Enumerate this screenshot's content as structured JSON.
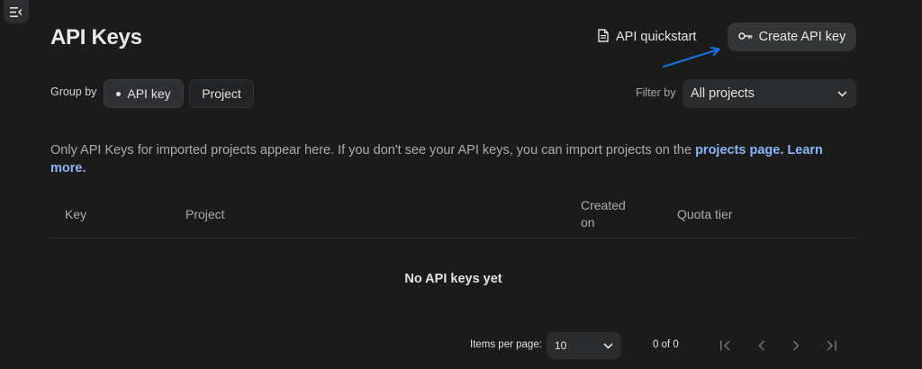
{
  "header": {
    "title": "API Keys",
    "quickstart_label": "API quickstart",
    "create_label": "Create API key"
  },
  "toolbar": {
    "group_by_label": "Group by",
    "group_options": [
      "API key",
      "Project"
    ],
    "selected_group": "API key",
    "filter_label": "Filter by",
    "filter_value": "All projects"
  },
  "info": {
    "text": "Only API Keys for imported projects appear here. If you don't see your API keys, you can import projects on the ",
    "link_label": "projects page. Learn more."
  },
  "table": {
    "columns": [
      "Key",
      "Project",
      "Created on",
      "Quota tier"
    ],
    "empty_message": "No API keys yet"
  },
  "pagination": {
    "items_per_page_label": "Items per page:",
    "items_per_page_value": "10",
    "range_text": "0 of 0"
  },
  "colors": {
    "background": "#1b1b1b",
    "button_bg": "#333537",
    "link": "#8ab4f8",
    "annotation_arrow": "#1a73e8"
  },
  "icons": {
    "sidebar_toggle": "menu-collapse-icon",
    "quickstart": "document-icon",
    "create": "key-icon",
    "filter_dropdown": "chevron-down-icon",
    "first_page": "first-page-icon",
    "prev_page": "chevron-left-icon",
    "next_page": "chevron-right-icon",
    "last_page": "last-page-icon"
  }
}
